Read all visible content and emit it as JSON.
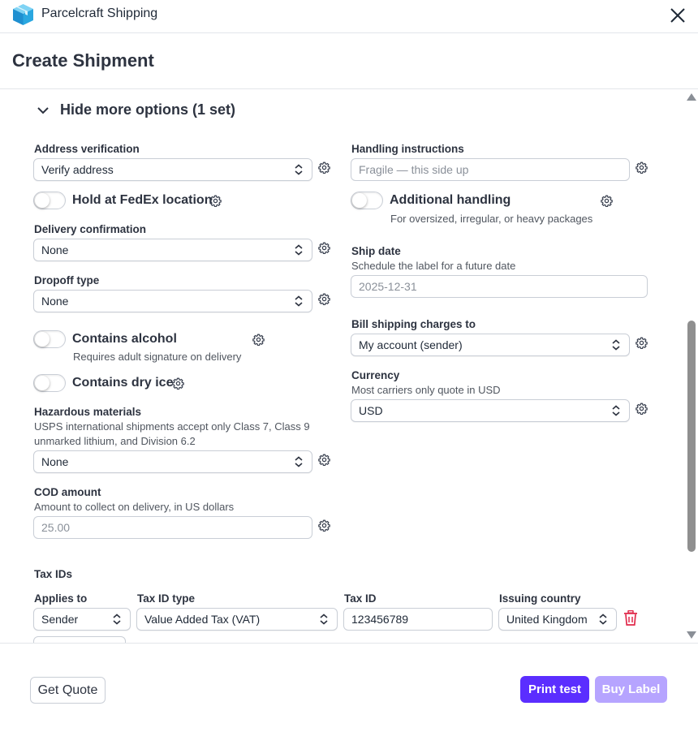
{
  "app": {
    "title": "Parcelcraft Shipping"
  },
  "page": {
    "title": "Create Shipment"
  },
  "section": {
    "toggle_label": "Hide more options (1 set)"
  },
  "left": {
    "address_verification": {
      "label": "Address verification",
      "value": "Verify address"
    },
    "hold_fedex": {
      "label": "Hold at FedEx location",
      "on": false
    },
    "delivery_confirmation": {
      "label": "Delivery confirmation",
      "value": "None"
    },
    "dropoff_type": {
      "label": "Dropoff type",
      "value": "None"
    },
    "contains_alcohol": {
      "label": "Contains alcohol",
      "help": "Requires adult signature on delivery",
      "on": false
    },
    "contains_dry_ice": {
      "label": "Contains dry ice",
      "on": false
    },
    "hazardous_materials": {
      "label": "Hazardous materials",
      "help_line1": "USPS international shipments accept only Class 7, Class 9",
      "help_line2": "unmarked lithium, and Division 6.2",
      "value": "None"
    },
    "cod_amount": {
      "label": "COD amount",
      "help": "Amount to collect on delivery, in US dollars",
      "placeholder": "25.00"
    }
  },
  "right": {
    "handling_instructions": {
      "label": "Handling instructions",
      "placeholder": "Fragile — this side up"
    },
    "additional_handling": {
      "label": "Additional handling",
      "help": "For oversized, irregular, or heavy packages",
      "on": false
    },
    "ship_date": {
      "label": "Ship date",
      "help": "Schedule the label for a future date",
      "placeholder": "2025-12-31"
    },
    "bill_to": {
      "label": "Bill shipping charges to",
      "value": "My account (sender)"
    },
    "currency": {
      "label": "Currency",
      "help": "Most carriers only quote in USD",
      "value": "USD"
    }
  },
  "tax_ids": {
    "title": "Tax IDs",
    "headers": {
      "applies_to": "Applies to",
      "type": "Tax ID type",
      "tax_id": "Tax ID",
      "country": "Issuing country"
    },
    "rows": [
      {
        "applies_to": "Sender",
        "type": "Value Added Tax (VAT)",
        "tax_id": "123456789",
        "country": "United Kingdom"
      }
    ]
  },
  "footer": {
    "get_quote": "Get Quote",
    "print_test": "Print test",
    "buy_label": "Buy Label"
  },
  "colors": {
    "primary": "#5b2eff",
    "primary_disabled": "#b6a4ff",
    "danger": "#e0294a",
    "logo": "#2aa7e0"
  }
}
